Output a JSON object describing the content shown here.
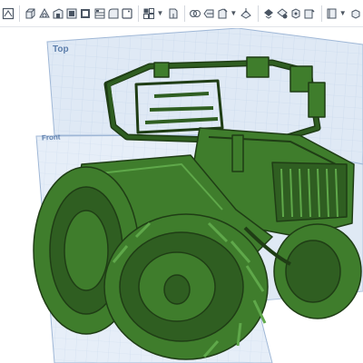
{
  "toolbar": {
    "items": [
      {
        "id": "sketch",
        "icon": "sketch-icon"
      },
      {
        "id": "extrude",
        "icon": "extrude-icon"
      },
      {
        "id": "revolve",
        "icon": "revolve-icon"
      },
      {
        "id": "sweep",
        "icon": "sweep-icon"
      },
      {
        "id": "loft",
        "icon": "loft-icon"
      },
      {
        "id": "thicken",
        "icon": "thicken-icon"
      },
      {
        "id": "enclose",
        "icon": "enclose-icon"
      },
      {
        "id": "fillet",
        "icon": "fillet-icon"
      },
      {
        "id": "chamfer",
        "icon": "chamfer-icon"
      },
      {
        "id": "pattern",
        "icon": "pattern-icon"
      },
      {
        "id": "shell",
        "icon": "shell-icon"
      },
      {
        "id": "draft",
        "icon": "draft-icon"
      },
      {
        "id": "boolean",
        "icon": "boolean-icon"
      },
      {
        "id": "split",
        "icon": "split-icon"
      },
      {
        "id": "transform",
        "icon": "transform-icon"
      },
      {
        "id": "mirror",
        "icon": "mirror-icon"
      },
      {
        "id": "plane",
        "icon": "plane-icon"
      },
      {
        "id": "mate-connector",
        "icon": "mate-connector-icon"
      },
      {
        "id": "measure",
        "icon": "measure-icon"
      },
      {
        "id": "section",
        "icon": "section-icon"
      },
      {
        "id": "view-cube",
        "icon": "view-cube-icon"
      }
    ]
  },
  "viewport": {
    "planes": {
      "top_label": "Top",
      "front_label": "Front"
    },
    "model_color": "#3f7d2c",
    "plane_color": "#c9d9ec"
  }
}
